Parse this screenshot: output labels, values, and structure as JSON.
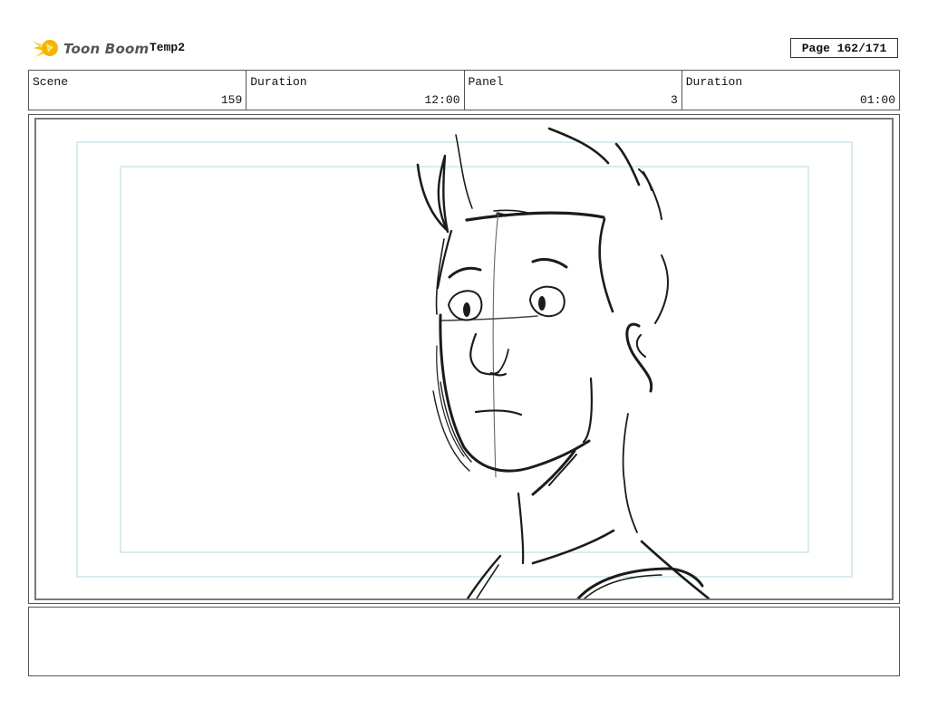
{
  "header": {
    "logo_text": "Toon Boom",
    "project_name": "Temp2",
    "page_label": "Page 162/171"
  },
  "info": {
    "scene_label": "Scene",
    "scene_value": "159",
    "scene_duration_label": "Duration",
    "scene_duration_value": "12:00",
    "panel_label": "Panel",
    "panel_value": "3",
    "panel_duration_label": "Duration",
    "panel_duration_value": "01:00"
  },
  "notes": {
    "text": ""
  }
}
